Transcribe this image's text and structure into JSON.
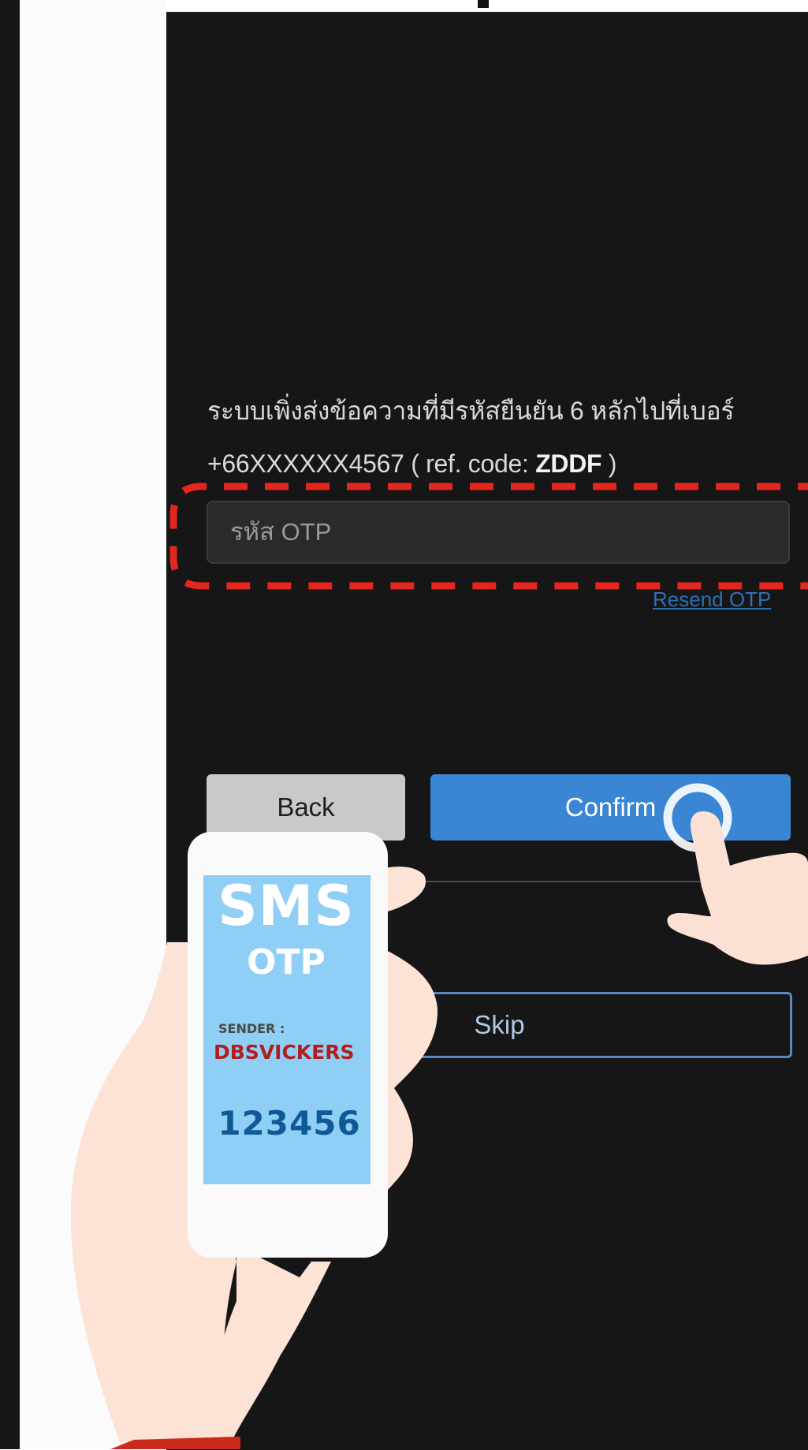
{
  "otp_screen": {
    "message_line1": "ระบบเพิ่งส่งข้อความที่มีรหัสยืนยัน 6 หลักไปที่เบอร์",
    "phone_number": "+66XXXXXX4567",
    "ref_prefix": " ( ref. code: ",
    "ref_code": "ZDDF",
    "ref_suffix": " )",
    "otp_placeholder": "รหัส OTP",
    "otp_value": "",
    "resend_label": "Resend OTP",
    "back_label": "Back",
    "confirm_label": "Confirm",
    "skip_label": "Skip"
  },
  "phone_sms": {
    "title": "SMS",
    "subtitle": "OTP",
    "sender_label": "SENDER :",
    "sender_name": "DBSVICKERS",
    "code": "123456"
  },
  "colors": {
    "screen_bg": "#161616",
    "confirm_button": "#3a86d4",
    "back_button": "#c9c9c9",
    "highlight_dash": "#e3261f",
    "sms_screen": "#8fcff6",
    "sender_name": "#b21e1e",
    "otp_code": "#0f5a96"
  },
  "icons": [
    "tap-gesture-icon",
    "pointing-hand-icon",
    "hand-holding-phone-icon"
  ]
}
